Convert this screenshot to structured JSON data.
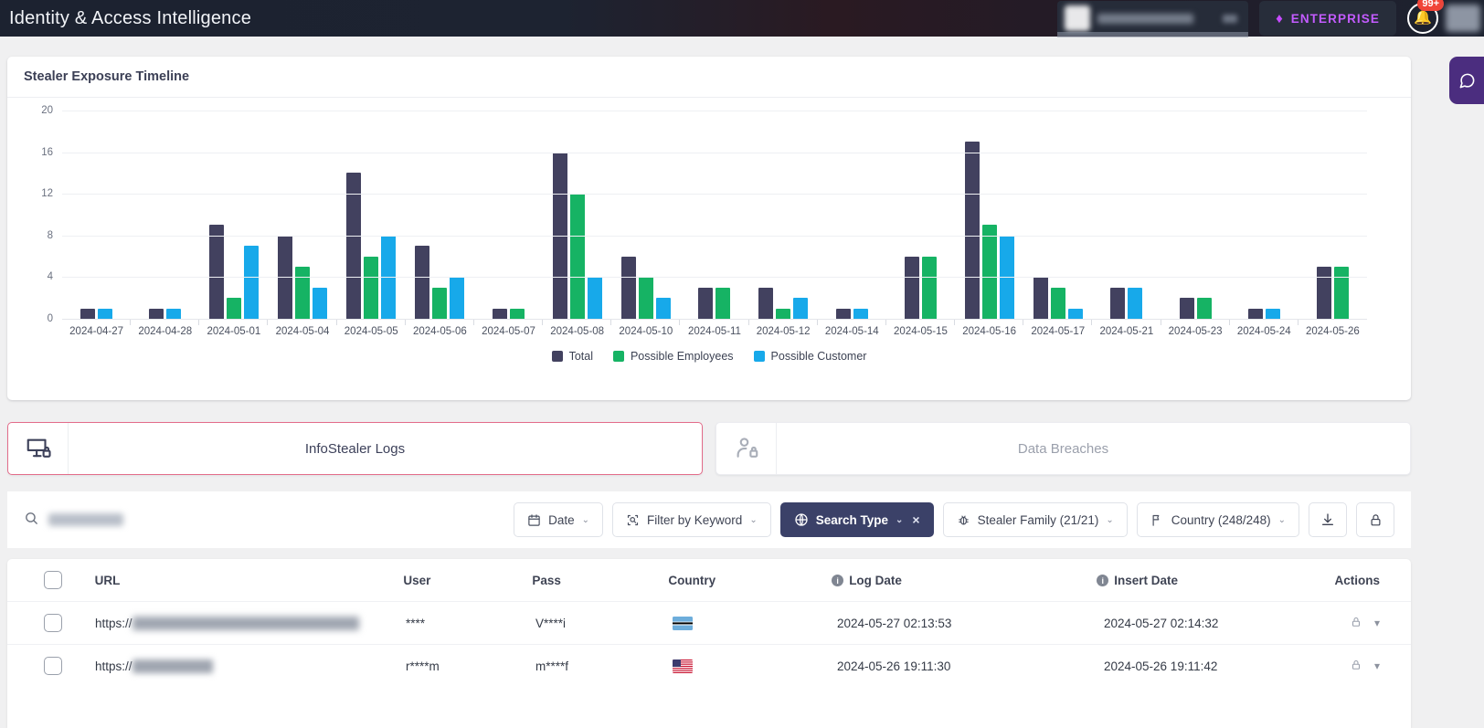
{
  "header": {
    "title": "Identity & Access Intelligence",
    "enterprise_label": "ENTERPRISE",
    "diamond_icon": "diamond-icon",
    "notification_count": "99+"
  },
  "chart_card": {
    "title": "Stealer Exposure Timeline"
  },
  "chart_data": {
    "type": "bar",
    "title": "Stealer Exposure Timeline",
    "xlabel": "",
    "ylabel": "",
    "ylim": [
      0,
      20
    ],
    "yticks": [
      0,
      4,
      8,
      12,
      16,
      20
    ],
    "grid": true,
    "legend_position": "bottom",
    "categories": [
      "2024-04-27",
      "2024-04-28",
      "2024-05-01",
      "2024-05-04",
      "2024-05-05",
      "2024-05-06",
      "2024-05-07",
      "2024-05-08",
      "2024-05-10",
      "2024-05-11",
      "2024-05-12",
      "2024-05-14",
      "2024-05-15",
      "2024-05-16",
      "2024-05-17",
      "2024-05-21",
      "2024-05-23",
      "2024-05-24",
      "2024-05-26"
    ],
    "series": [
      {
        "name": "Total",
        "color": "#42415f",
        "values": [
          1,
          1,
          9,
          8,
          14,
          7,
          1,
          16,
          6,
          3,
          3,
          1,
          6,
          17,
          4,
          3,
          2,
          1,
          5
        ]
      },
      {
        "name": "Possible Employees",
        "color": "#16b364",
        "values": [
          0,
          0,
          2,
          5,
          6,
          3,
          1,
          12,
          4,
          3,
          1,
          0,
          6,
          9,
          3,
          0,
          2,
          0,
          5
        ]
      },
      {
        "name": "Possible Customer",
        "color": "#17a9ea",
        "values": [
          1,
          1,
          7,
          3,
          8,
          4,
          0,
          4,
          2,
          0,
          2,
          1,
          0,
          8,
          1,
          3,
          0,
          1,
          0
        ]
      }
    ]
  },
  "tabs": [
    {
      "label": "InfoStealer Logs",
      "icon": "monitor-lock-icon",
      "active": true
    },
    {
      "label": "Data Breaches",
      "icon": "user-lock-icon",
      "active": false
    }
  ],
  "toolbar": {
    "search_placeholder": "",
    "search_icon": "search-icon",
    "buttons": [
      {
        "label": "Date",
        "icon": "calendar-icon",
        "caret": "⌄",
        "style": "light"
      },
      {
        "label": "Filter by Keyword",
        "icon": "keyword-search-icon",
        "caret": "⌄",
        "style": "light"
      },
      {
        "label": "Search Type",
        "icon": "globe-icon",
        "caret": "⌄",
        "clear": "×",
        "style": "dark"
      },
      {
        "label": "Stealer Family (21/21)",
        "icon": "bug-icon",
        "caret": "⌄",
        "style": "light"
      },
      {
        "label": "Country (248/248)",
        "icon": "flag-icon",
        "caret": "⌄",
        "style": "light"
      }
    ],
    "download_icon": "download-icon",
    "lock_icon": "lock-icon"
  },
  "table": {
    "columns": {
      "url": "URL",
      "user": "User",
      "pass": "Pass",
      "country": "Country",
      "log_date": "Log Date",
      "insert_date": "Insert Date",
      "actions": "Actions"
    },
    "rows": [
      {
        "url_prefix": "https://",
        "user": "****",
        "pass": "V****i",
        "country_flag": "botswana-flag",
        "log_date": "2024-05-27 02:13:53",
        "insert_date": "2024-05-27 02:14:32"
      },
      {
        "url_prefix": "https://",
        "user": "r****m",
        "pass": "m****f",
        "country_flag": "united-states-flag",
        "log_date": "2024-05-26 19:11:30",
        "insert_date": "2024-05-26 19:11:42"
      }
    ]
  },
  "colors": {
    "total": "#42415f",
    "possible_employees": "#16b364",
    "possible_customer": "#17a9ea",
    "accent_dark": "#3b4168",
    "active_tab_border": "#e36c8a",
    "enterprise": "#c35bff",
    "badge": "#f04438"
  }
}
